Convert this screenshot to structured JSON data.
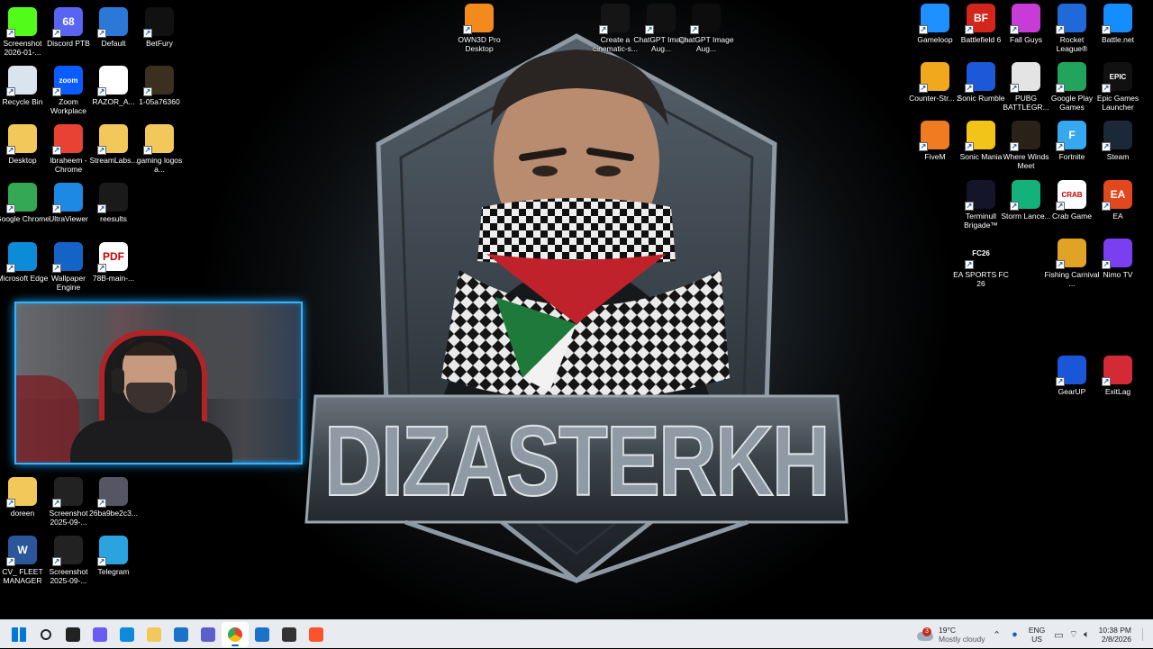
{
  "wallpaper": {
    "title_text": "DIZASTERKH"
  },
  "desktop_icons_left": [
    {
      "label": "Screenshot 2026-01-...",
      "icon": "kick-icon",
      "color": "#53fc18"
    },
    {
      "label": "Discord PTB",
      "icon": "discord-icon",
      "color": "#5865f2",
      "text": "68"
    },
    {
      "label": "Default",
      "icon": "monitor-icon",
      "color": "#2b78d8"
    },
    {
      "label": "BetFury",
      "icon": "betfury-icon",
      "color": "#111"
    },
    {
      "label": "Recycle Bin",
      "icon": "recycle-bin-icon",
      "color": "#d9e4ee"
    },
    {
      "label": "Zoom Workplace",
      "icon": "zoom-icon",
      "color": "#0b5cff",
      "text": "zoom"
    },
    {
      "label": "RAZOR_A...",
      "icon": "file-icon",
      "color": "#ffffff"
    },
    {
      "label": "1-05a76360",
      "icon": "image-thumb-icon",
      "color": "#3b2f1f"
    },
    {
      "label": "Desktop",
      "icon": "folder-icon",
      "color": "#f3c85a"
    },
    {
      "label": "Ibraheem - Chrome",
      "icon": "chrome-icon",
      "color": "#e94235"
    },
    {
      "label": "StreamLabs...",
      "icon": "folder-icon",
      "color": "#f3c85a"
    },
    {
      "label": "gaming logos a...",
      "icon": "folder-icon",
      "color": "#f3c85a"
    },
    {
      "label": "Google Chrome",
      "icon": "chrome-icon",
      "color": "#34a853"
    },
    {
      "label": "UltraViewer",
      "icon": "ultraviewer-icon",
      "color": "#1e88e5"
    },
    {
      "label": "reesults",
      "icon": "image-thumb-icon",
      "color": "#1a1a1a"
    },
    {
      "label": "Microsoft Edge",
      "icon": "edge-icon",
      "color": "#0c8bd8"
    },
    {
      "label": "Wallpaper Engine",
      "icon": "wallpaper-engine-icon",
      "color": "#1464c8"
    },
    {
      "label": "78B-main-...",
      "icon": "pdf-icon",
      "color": "#ffffff",
      "text": "PDF"
    },
    {
      "label": "doreen",
      "icon": "folder-icon",
      "color": "#f3c85a"
    },
    {
      "label": "Screenshot 2025-09-...",
      "icon": "image-thumb-icon",
      "color": "#222"
    },
    {
      "label": "26ba9be2c3...",
      "icon": "image-thumb-icon",
      "color": "#556"
    },
    {
      "label": "CV_ FLEET MANAGER",
      "icon": "word-icon",
      "color": "#2b579a",
      "text": "W"
    },
    {
      "label": "Screenshot 2025-09-...",
      "icon": "image-thumb-icon",
      "color": "#222"
    },
    {
      "label": "Telegram",
      "icon": "telegram-icon",
      "color": "#2aa3df"
    }
  ],
  "desktop_icons_top": [
    {
      "label": "OWN3D Pro Desktop",
      "icon": "own3d-icon",
      "color": "#f28a1e"
    },
    {
      "label": "Create a cinematic-s...",
      "icon": "image-thumb-icon",
      "color": "#151515"
    },
    {
      "label": "ChatGPT Image Aug...",
      "icon": "image-thumb-icon",
      "color": "#111"
    },
    {
      "label": "ChatGPT Image Aug...",
      "icon": "image-thumb-icon",
      "color": "#0d0d0d"
    }
  ],
  "desktop_icons_right": [
    {
      "label": "Gameloop",
      "icon": "gameloop-icon",
      "color": "#1e90ff"
    },
    {
      "label": "Battlefield 6",
      "icon": "battlefield-icon",
      "color": "#d2261c",
      "text": "BF"
    },
    {
      "label": "Fall Guys",
      "icon": "fall-guys-icon",
      "color": "#c93bd6"
    },
    {
      "label": "Rocket League®",
      "icon": "rocket-league-icon",
      "color": "#1f6ad8"
    },
    {
      "label": "Battle.net",
      "icon": "battlenet-icon",
      "color": "#148eff"
    },
    {
      "label": "Counter-Str... 2",
      "icon": "cs2-icon",
      "color": "#f1a81c"
    },
    {
      "label": "Sonic Rumble",
      "icon": "sonic-icon",
      "color": "#1c59d8"
    },
    {
      "label": "PUBG BATTLEGR...",
      "icon": "pubg-icon",
      "color": "#e4e4e4"
    },
    {
      "label": "Google Play Games",
      "icon": "play-games-icon",
      "color": "#22a45d"
    },
    {
      "label": "Epic Games Launcher",
      "icon": "epic-games-icon",
      "color": "#111",
      "text": "EPIC"
    },
    {
      "label": "FiveM",
      "icon": "fivem-icon",
      "color": "#f07b21"
    },
    {
      "label": "Sonic Mania",
      "icon": "sonic-icon",
      "color": "#f2c419"
    },
    {
      "label": "Where Winds Meet",
      "icon": "where-winds-meet-icon",
      "color": "#2a2218"
    },
    {
      "label": "Fortnite",
      "icon": "fortnite-icon",
      "color": "#35a8f0",
      "text": "F"
    },
    {
      "label": "Steam",
      "icon": "steam-icon",
      "color": "#1b2838"
    },
    {
      "label": "Terminull Brigade™",
      "icon": "terminull-icon",
      "color": "#14142a"
    },
    {
      "label": "Storm Lance...",
      "icon": "storm-lancers-icon",
      "color": "#12b27a"
    },
    {
      "label": "Crab Game",
      "icon": "crab-game-icon",
      "color": "#ffffff",
      "text": "CRAB"
    },
    {
      "label": "EA",
      "icon": "ea-icon",
      "color": "#e2471d",
      "text": "EA"
    },
    {
      "label": "EA SPORTS FC 26",
      "icon": "fc26-icon",
      "color": "#000",
      "text": "FC26"
    },
    {
      "label": "Fishing Carnival ...",
      "icon": "fishing-carnival-icon",
      "color": "#e0a326"
    },
    {
      "label": "Nimo TV",
      "icon": "nimo-tv-icon",
      "color": "#7b3ff2"
    },
    {
      "label": "GearUP",
      "icon": "gearup-icon",
      "color": "#1a56d8"
    },
    {
      "label": "ExitLag",
      "icon": "exitlag-icon",
      "color": "#d42a36"
    }
  ],
  "taskbar": {
    "apps": [
      {
        "name": "start-button",
        "color": "#0078d4"
      },
      {
        "name": "search-button",
        "color": "#222"
      },
      {
        "name": "task-view-button",
        "color": "#222"
      },
      {
        "name": "copilot-button",
        "color": "#6a5cf0"
      },
      {
        "name": "edge-taskbar",
        "color": "#0c8bd8"
      },
      {
        "name": "file-explorer-taskbar",
        "color": "#f3c85a"
      },
      {
        "name": "microsoft-store-taskbar",
        "color": "#1a73c8"
      },
      {
        "name": "teams-taskbar",
        "color": "#5b5fc7"
      },
      {
        "name": "chrome-taskbar",
        "color": "#e94235"
      },
      {
        "name": "outlook-taskbar",
        "color": "#1a73c8"
      },
      {
        "name": "obs-taskbar",
        "color": "#333"
      },
      {
        "name": "brave-taskbar",
        "color": "#fb542b"
      }
    ],
    "weather": {
      "temp": "19°C",
      "desc": "Mostly cloudy",
      "badge": "3"
    },
    "lang": {
      "line1": "ENG",
      "line2": "US"
    },
    "clock": {
      "time": "10:38 PM",
      "date": "2/8/2026"
    }
  }
}
